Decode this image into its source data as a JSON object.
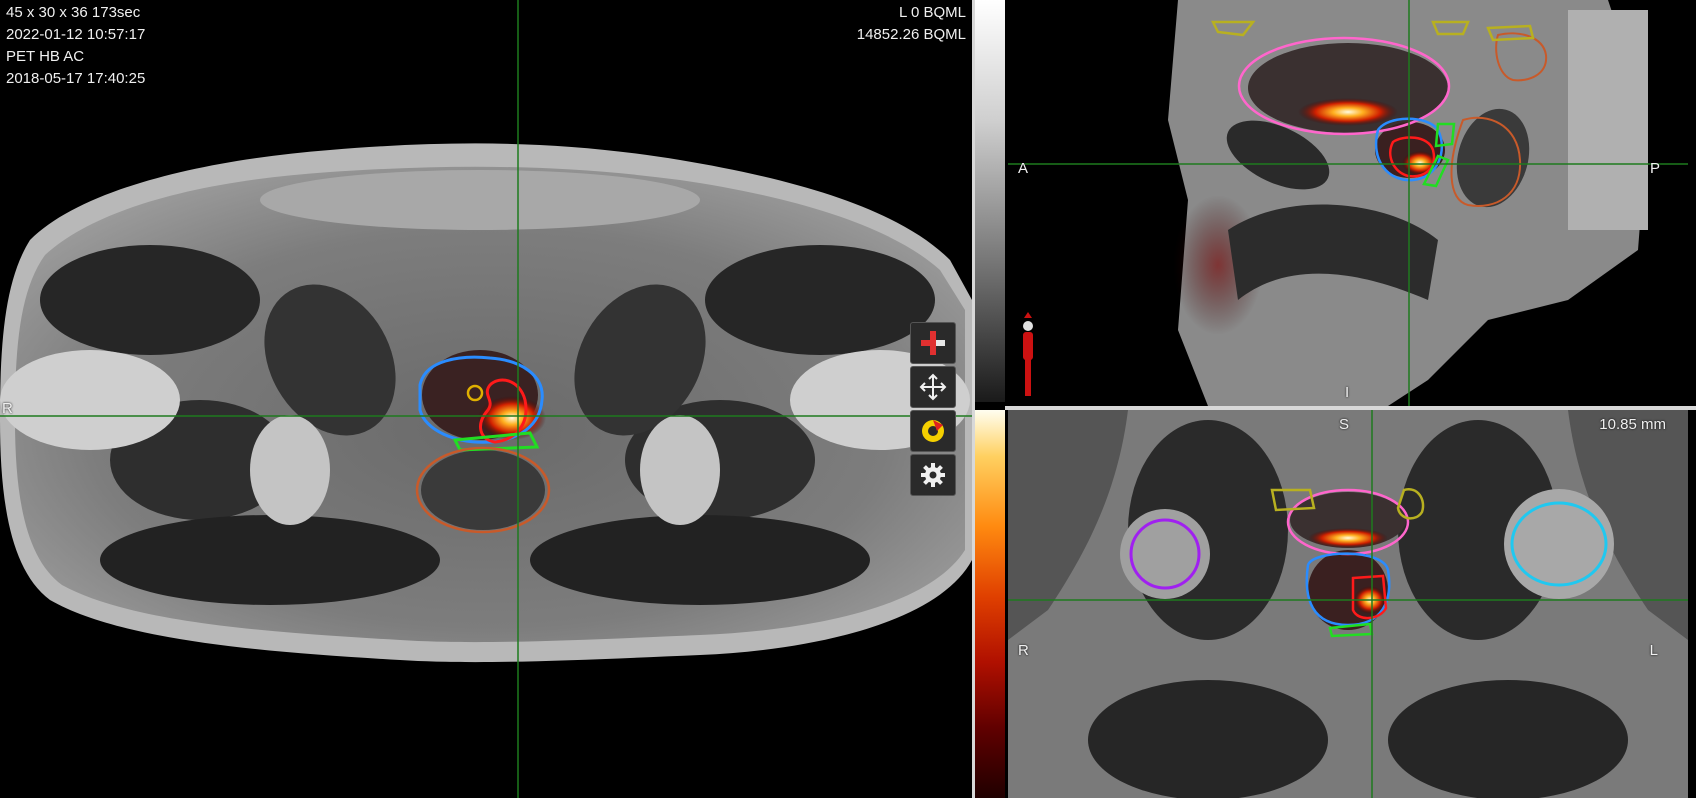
{
  "axial_view": {
    "info_lines": [
      "45 x 30 x 36 173sec",
      "2022-01-12 10:57:17",
      "PET HB AC",
      "2018-05-17 17:40:25"
    ],
    "window_min": "L 0 BQML",
    "window_max": "14852.26 BQML",
    "orientation_right": "R"
  },
  "sagittal_view": {
    "orientation_anterior": "A",
    "orientation_posterior": "P",
    "orientation_inferior": "I"
  },
  "coronal_view": {
    "orientation_superior": "S",
    "orientation_right": "R",
    "orientation_left": "L",
    "slice_thickness": "10.85 mm"
  },
  "toolbar": {
    "tools": [
      {
        "icon": "crosshair-plus-icon"
      },
      {
        "icon": "pan-move-icon"
      },
      {
        "icon": "rotate-reset-icon"
      },
      {
        "icon": "settings-gear-icon"
      }
    ]
  },
  "colors": {
    "crosshair": "#1e7a1e",
    "contour_blue": "#2a8cff",
    "contour_red": "#ff1a1a",
    "contour_green": "#22dd22",
    "contour_orange": "#c85a2a",
    "contour_pink": "#ff66cc",
    "contour_yellow": "#b8b020",
    "contour_purple": "#a020f0",
    "contour_cyan": "#20c8f0"
  }
}
